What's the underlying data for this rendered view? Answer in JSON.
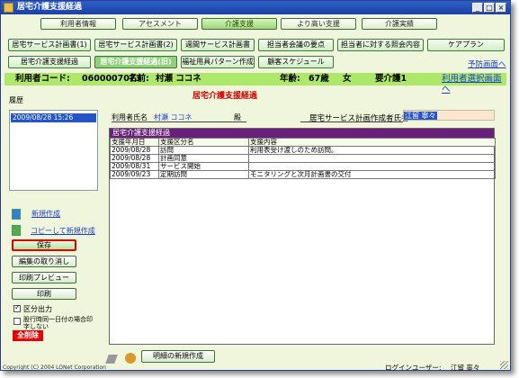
{
  "window": {
    "title": "居宅介護支援経過",
    "min_label": "_",
    "max_label": "□",
    "close_label": "×"
  },
  "main_nav": [
    {
      "label": "利用者情報"
    },
    {
      "label": "アセスメント"
    },
    {
      "label": "介護支援"
    },
    {
      "label": "より高い支援"
    },
    {
      "label": "介護実績"
    }
  ],
  "sub_nav_row1": [
    {
      "label": "居宅サービス計画書(1)"
    },
    {
      "label": "居宅サービス計画書(2)"
    },
    {
      "label": "週間サービス計画書"
    },
    {
      "label": "担当者会議の要点"
    },
    {
      "label": "担当者に対する照会内容"
    },
    {
      "label": "ケアプラン"
    }
  ],
  "sub_nav_row2": [
    {
      "label": "居宅介護支援経過"
    },
    {
      "label": "居宅介護支援経過(旧)"
    },
    {
      "label": "福祉用具パターン作成"
    },
    {
      "label": "顧客スケジュール"
    }
  ],
  "links": {
    "prevention_screen": "予防画面へ",
    "user_select_screen": "利用者選択画面へ"
  },
  "user_info": {
    "code_label": "利用者コード:",
    "code_value": "0600007073",
    "name_label": "名前:",
    "name_value": "村瀬 ココネ",
    "age_label": "年齢:",
    "age_value": "67歳",
    "gender": "女",
    "care_level": "要介護1"
  },
  "page_title": "居宅介護支援経過",
  "history": {
    "label": "履歴",
    "items": [
      "2009/08/28 15:26"
    ]
  },
  "form": {
    "user_name_label": "利用者氏名",
    "user_name_value": "村瀬 ココネ",
    "honorific": "殿",
    "creator_label": "居宅サービス計画作成者氏名",
    "creator_value": "江留 寧々"
  },
  "table": {
    "caption": "居宅介護支援経過",
    "headers": [
      "支援年月日",
      "支援区分名",
      "支援内容"
    ],
    "rows": [
      [
        "2009/08/28",
        "訪問",
        "利用表受け渡しのため訪問。"
      ],
      [
        "2009/08/28",
        "計画同意",
        ""
      ],
      [
        "2009/08/31",
        "サービス開始",
        ""
      ],
      [
        "2009/09/23",
        "定期訪問",
        "モニタリングと次月計画書の交付"
      ]
    ]
  },
  "actions": {
    "new_create": "新規作成",
    "copy_new": "コピーして新規作成",
    "save": "保存",
    "cancel_edit": "編集の取り消し",
    "print_preview": "印刷プレビュー",
    "print": "印刷",
    "section_output": "区分出力",
    "same_day_print": "股行時同一日付の場合印字しない",
    "delete_all": "全削除",
    "new_detail": "明細の新規作成"
  },
  "footer": {
    "copyright": "Copyright (C) 2004 LONet Corporation",
    "login_label": "ログインユーザー:",
    "login_user": "江留 寧々"
  },
  "colors": {
    "info_bar": "#aee86a",
    "title_red": "#d20000",
    "table_caption": "#6a1f7a",
    "save_border": "#e00000",
    "delete_bg": "#e80000"
  }
}
